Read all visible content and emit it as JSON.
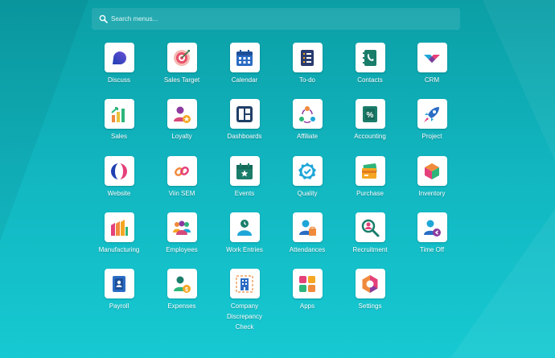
{
  "search": {
    "placeholder": "Search menus..."
  },
  "apps": [
    {
      "label": "Discuss",
      "icon": "discuss-icon"
    },
    {
      "label": "Sales Target",
      "icon": "sales-target-icon"
    },
    {
      "label": "Calendar",
      "icon": "calendar-icon"
    },
    {
      "label": "To-do",
      "icon": "todo-icon"
    },
    {
      "label": "Contacts",
      "icon": "contacts-icon"
    },
    {
      "label": "CRM",
      "icon": "crm-icon"
    },
    {
      "label": "Sales",
      "icon": "sales-icon"
    },
    {
      "label": "Loyalty",
      "icon": "loyalty-icon"
    },
    {
      "label": "Dashboards",
      "icon": "dashboards-icon"
    },
    {
      "label": "Affiliate",
      "icon": "affiliate-icon"
    },
    {
      "label": "Accounting",
      "icon": "accounting-icon"
    },
    {
      "label": "Project",
      "icon": "project-icon"
    },
    {
      "label": "Website",
      "icon": "website-icon"
    },
    {
      "label": "Viin SEM",
      "icon": "viin-sem-icon"
    },
    {
      "label": "Events",
      "icon": "events-icon"
    },
    {
      "label": "Quality",
      "icon": "quality-icon"
    },
    {
      "label": "Purchase",
      "icon": "purchase-icon"
    },
    {
      "label": "Inventory",
      "icon": "inventory-icon"
    },
    {
      "label": "Manufacturing",
      "icon": "manufacturing-icon"
    },
    {
      "label": "Employees",
      "icon": "employees-icon"
    },
    {
      "label": "Work Entries",
      "icon": "work-entries-icon"
    },
    {
      "label": "Attendances",
      "icon": "attendances-icon"
    },
    {
      "label": "Recruitment",
      "icon": "recruitment-icon"
    },
    {
      "label": "Time Off",
      "icon": "time-off-icon"
    },
    {
      "label": "Payroll",
      "icon": "payroll-icon"
    },
    {
      "label": "Expenses",
      "icon": "expenses-icon"
    },
    {
      "label": "Company Discrepancy Check",
      "icon": "company-discrepancy-check-icon"
    },
    {
      "label": "Apps",
      "icon": "apps-icon"
    },
    {
      "label": "Settings",
      "icon": "settings-icon"
    }
  ]
}
